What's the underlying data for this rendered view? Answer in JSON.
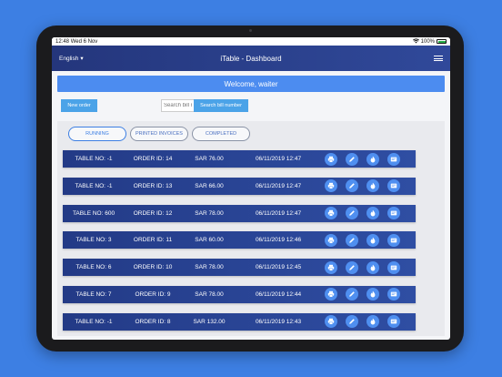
{
  "status": {
    "time": "12:48",
    "date": "Wed 6 Nov",
    "battery": "100%"
  },
  "nav": {
    "language": "English",
    "title": "iTable - Dashboard"
  },
  "welcome": "Welcome, waiter",
  "toolbar": {
    "new_order_label": "New order",
    "search_placeholder": "Search bill number",
    "search_button_label": "Search bill number"
  },
  "tabs": [
    {
      "label": "RUNNING",
      "active": true
    },
    {
      "label": "PRINTED INVOICES",
      "active": false
    },
    {
      "label": "COMPLETED",
      "active": false
    }
  ],
  "action_icons": [
    "print-icon",
    "edit-icon",
    "fire-icon",
    "invoice-icon"
  ],
  "orders": [
    {
      "table": "TABLE NO: -1",
      "order": "ORDER ID: 14",
      "amount": "SAR 76.00",
      "datetime": "06/11/2019 12:47"
    },
    {
      "table": "TABLE NO: -1",
      "order": "ORDER ID: 13",
      "amount": "SAR 66.00",
      "datetime": "06/11/2019 12:47"
    },
    {
      "table": "TABLE NO: 600",
      "order": "ORDER ID: 12",
      "amount": "SAR 78.00",
      "datetime": "06/11/2019 12:47"
    },
    {
      "table": "TABLE NO: 3",
      "order": "ORDER ID: 11",
      "amount": "SAR 60.00",
      "datetime": "06/11/2019 12:46"
    },
    {
      "table": "TABLE NO: 6",
      "order": "ORDER ID: 10",
      "amount": "SAR 78.00",
      "datetime": "06/11/2019 12:45"
    },
    {
      "table": "TABLE NO: 7",
      "order": "ORDER ID: 9",
      "amount": "SAR 78.00",
      "datetime": "06/11/2019 12:44"
    },
    {
      "table": "TABLE NO: -1",
      "order": "ORDER ID: 8",
      "amount": "SAR 132.00",
      "datetime": "06/11/2019 12:43"
    }
  ],
  "colors": {
    "background": "#3d7fe3",
    "navbar": "#2a3f8c",
    "accent": "#4c8cf0",
    "row": "#2a4396"
  }
}
